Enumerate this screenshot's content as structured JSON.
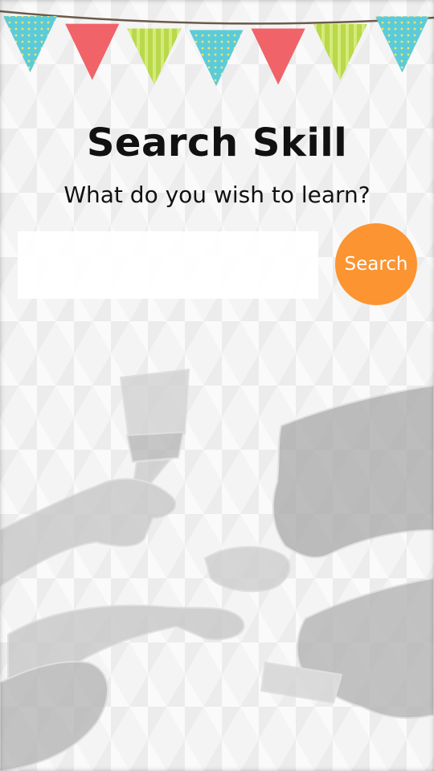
{
  "header": {
    "title": "Search Skill",
    "subtitle": "What do you wish to learn?"
  },
  "search": {
    "placeholder": "",
    "value": "",
    "button_label": "Search"
  },
  "bunting": {
    "flags": [
      {
        "color": "#5ccbd9",
        "pattern": "dots"
      },
      {
        "color": "#f06368",
        "pattern": "solid"
      },
      {
        "color": "#b8d94a",
        "pattern": "stripes"
      },
      {
        "color": "#5ccbd9",
        "pattern": "dots"
      },
      {
        "color": "#f06368",
        "pattern": "solid"
      },
      {
        "color": "#b8d94a",
        "pattern": "stripes"
      },
      {
        "color": "#5ccbd9",
        "pattern": "dots"
      }
    ]
  },
  "colors": {
    "accent": "#fb9431",
    "text": "#111111",
    "illustration": "#bdbdbd"
  }
}
